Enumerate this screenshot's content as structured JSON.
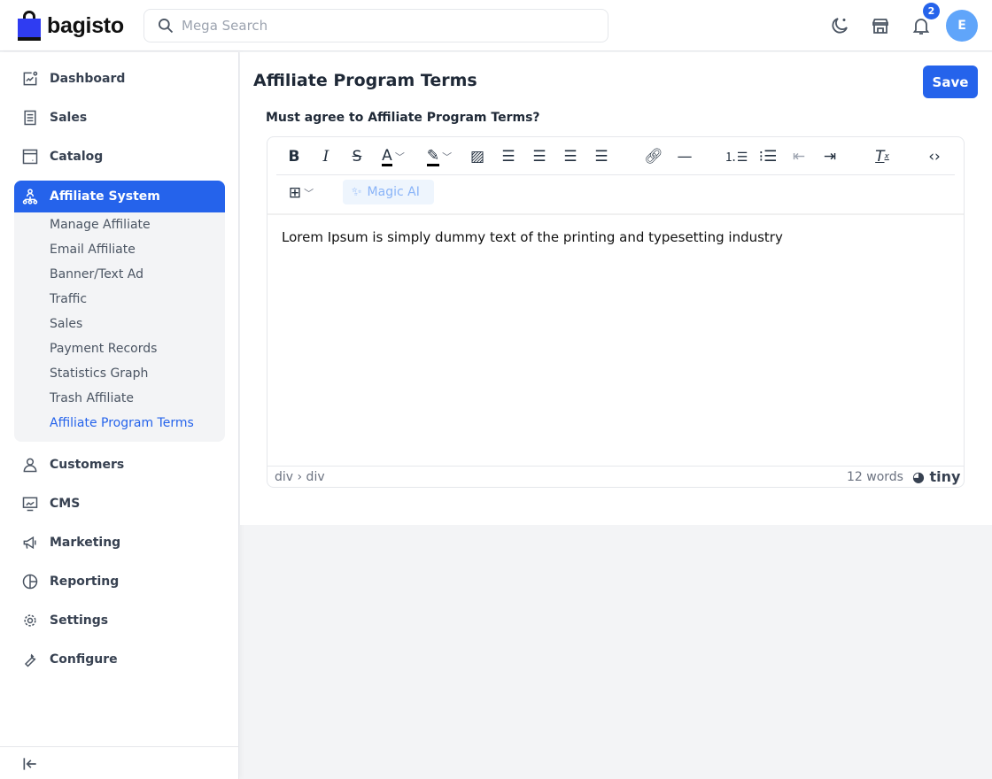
{
  "header": {
    "brand": "bagisto",
    "search_placeholder": "Mega Search",
    "notification_count": "2",
    "avatar_initial": "E"
  },
  "sidebar": {
    "items": [
      {
        "label": "Dashboard",
        "icon": "dashboard-icon"
      },
      {
        "label": "Sales",
        "icon": "sales-icon"
      },
      {
        "label": "Catalog",
        "icon": "catalog-icon"
      },
      {
        "label": "Affiliate System",
        "icon": "affiliate-icon"
      },
      {
        "label": "Customers",
        "icon": "customers-icon"
      },
      {
        "label": "CMS",
        "icon": "cms-icon"
      },
      {
        "label": "Marketing",
        "icon": "marketing-icon"
      },
      {
        "label": "Reporting",
        "icon": "reporting-icon"
      },
      {
        "label": "Settings",
        "icon": "settings-icon"
      },
      {
        "label": "Configure",
        "icon": "configure-icon"
      }
    ],
    "submenu": [
      "Manage Affiliate",
      "Email Affiliate",
      "Banner/Text Ad",
      "Traffic",
      "Sales",
      "Payment Records",
      "Statistics Graph",
      "Trash Affiliate",
      "Affiliate Program Terms"
    ]
  },
  "main": {
    "title": "Affiliate Program Terms",
    "save_label": "Save",
    "field_label": "Must agree to Affiliate Program Terms?",
    "editor": {
      "magic_ai": "Magic AI",
      "content": "Lorem Ipsum is simply dummy text of the printing and typesetting industry",
      "path": "div › div",
      "word_count": "12 words",
      "brand": "tiny"
    }
  },
  "colors": {
    "accent": "#2563eb"
  }
}
